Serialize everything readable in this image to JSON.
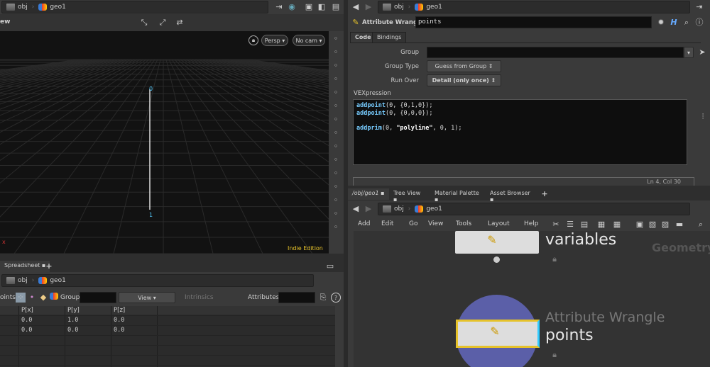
{
  "left": {
    "path": {
      "obj": "obj",
      "geo": "geo1"
    },
    "viewport": {
      "title": "ew",
      "persp": "Persp",
      "cam": "No cam",
      "edition": "Indie Edition",
      "point_labels": [
        "0",
        "1"
      ]
    },
    "spreadsheet": {
      "tab": "Spreadsheet",
      "path": {
        "obj": "obj",
        "geo": "geo1"
      },
      "mode": "oints",
      "group_label": "Group:",
      "view": "View",
      "intrinsics": "Intrinsics",
      "attributes_label": "Attributes:",
      "columns": [
        "P[x]",
        "P[y]",
        "P[z]"
      ],
      "rows": [
        [
          "0.0",
          "1.0",
          "0.0"
        ],
        [
          "0.0",
          "0.0",
          "0.0"
        ]
      ]
    }
  },
  "right": {
    "path": {
      "obj": "obj",
      "geo": "geo1"
    },
    "node_type": "Attribute Wrangle",
    "node_name": "points",
    "tabs": [
      "Code",
      "Bindings"
    ],
    "params": {
      "group_label": "Group",
      "group_value": "",
      "group_type_label": "Group Type",
      "group_type": "Guess from Group",
      "run_over_label": "Run Over",
      "run_over": "Detail (only once)",
      "vex_label": "VEXpression"
    },
    "code": [
      "addpoint(0, {0,1,0});",
      "addpoint(0, {0,0,0});",
      "",
      "addprim(0, \"polyline\", 0, 1);"
    ],
    "status": "Ln 4, Col 30",
    "pane_tabs": [
      "/obj/geo1",
      "Tree View",
      "Material Palette",
      "Asset Browser"
    ],
    "net_path": {
      "obj": "obj",
      "geo": "geo1"
    },
    "menu": [
      "Add",
      "Edit",
      "Go",
      "View",
      "Tools",
      "Layout",
      "Help"
    ],
    "nodes": [
      {
        "type": "",
        "name": "variables"
      },
      {
        "type": "Attribute Wrangle",
        "name": "points"
      }
    ],
    "context_label": "Geometry"
  }
}
